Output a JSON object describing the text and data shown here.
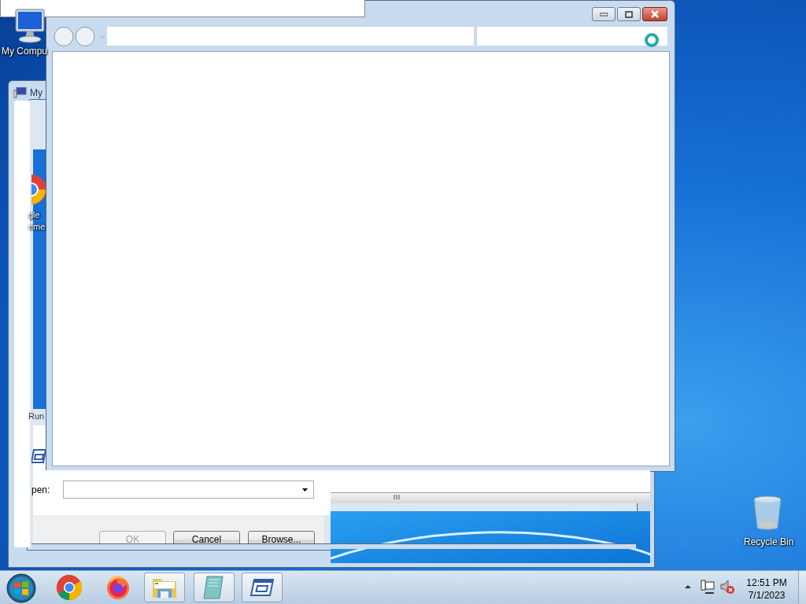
{
  "desktop_icons": [
    {
      "kind": "computer",
      "label": "My Compu"
    },
    {
      "kind": "recycle-bin",
      "label": "Recycle Bin"
    }
  ],
  "explorer_window": {
    "title": "My"
  },
  "run_dialog": {
    "title": "Run",
    "shortcut_label_lines": [
      "gle",
      "eme"
    ],
    "open_label": "pen:",
    "buttons": [
      {
        "label": "OK",
        "disabled": true
      },
      {
        "label": "Cancel",
        "disabled": false
      },
      {
        "label": "Browse...",
        "disabled": false
      }
    ]
  },
  "taskbar": {
    "apps": [
      {
        "kind": "chrome",
        "running": false
      },
      {
        "kind": "firefox",
        "running": false
      },
      {
        "kind": "explorer",
        "running": true
      },
      {
        "kind": "notepad",
        "running": true
      },
      {
        "kind": "run",
        "running": true
      }
    ]
  },
  "clock": {
    "time": "12:51 PM",
    "date": "7/1/2023"
  }
}
